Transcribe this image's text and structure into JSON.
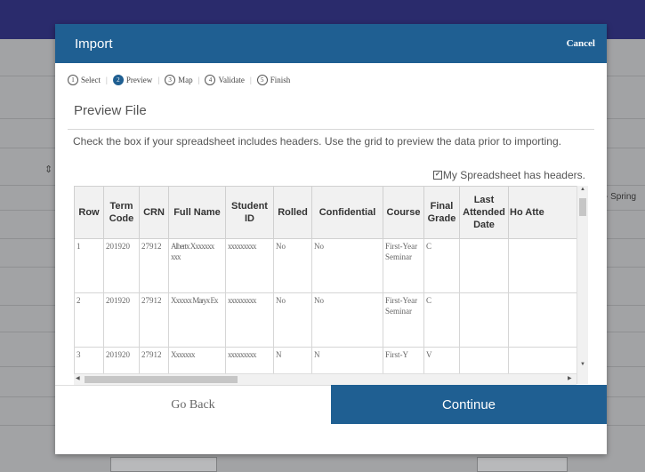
{
  "background": {
    "right_text": "- Spring"
  },
  "modal": {
    "title": "Import",
    "cancel_label": "Cancel",
    "steps": [
      {
        "num": "1",
        "label": "Select"
      },
      {
        "num": "2",
        "label": "Preview"
      },
      {
        "num": "3",
        "label": "Map"
      },
      {
        "num": "4",
        "label": "Validate"
      },
      {
        "num": "5",
        "label": "Finish"
      }
    ],
    "section_title": "Preview File",
    "instructions": "Check the box if your spreadsheet includes headers. Use the grid to preview the data prior to importing.",
    "headers_checkbox_label": "My Spreadsheet has headers.",
    "grid": {
      "columns": [
        "Row",
        "Term Code",
        "CRN",
        "Full Name",
        "Student ID",
        "Rolled",
        "Confidential",
        "Course",
        "Final Grade",
        "Last Attended Date",
        "Ho Atte"
      ],
      "rows": [
        [
          "1",
          "201920",
          "27912",
          "Albertx Xxxxxxx xxx",
          "xxxxxxxxx",
          "No",
          "No",
          "First-Year Seminar",
          "C",
          "",
          ""
        ],
        [
          "2",
          "201920",
          "27912",
          "Xxxxxx Maryx Ex",
          "xxxxxxxxx",
          "No",
          "No",
          "First-Year Seminar",
          "C",
          "",
          ""
        ],
        [
          "3",
          "201920",
          "27912",
          "Xxxxxxx",
          "xxxxxxxxx",
          "N",
          "N",
          "First-Y",
          "V",
          "",
          ""
        ]
      ]
    },
    "go_back_label": "Go Back",
    "continue_label": "Continue"
  }
}
